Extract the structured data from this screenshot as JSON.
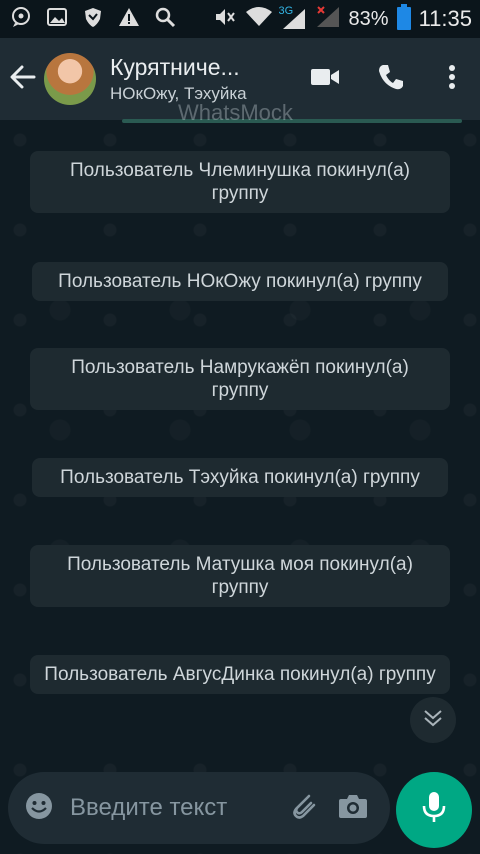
{
  "status_bar": {
    "network_label": "3G",
    "battery_percent": "83%",
    "time": "11:35",
    "icons": [
      "chat-bubble-icon",
      "image-icon",
      "shield-icon",
      "warning-icon",
      "search-icon",
      "mute-icon",
      "wifi-icon",
      "signal-3g-icon",
      "signal-icon",
      "battery-icon"
    ]
  },
  "header": {
    "title": "Курятниче...",
    "subtitle": "НОкОжу, Тэхуйка"
  },
  "watermark": "WhatsMock",
  "messages": [
    {
      "text": "Пользователь Члеминушка покинул(а) группу"
    },
    {
      "text": "Пользователь НОкОжу покинул(а) группу"
    },
    {
      "text": "Пользователь Намрукажёп покинул(а) группу"
    },
    {
      "text": "Пользователь Тэхуйка покинул(а) группу"
    },
    {
      "text": "Пользователь Матушка моя покинул(а) группу"
    },
    {
      "text": "Пользователь АвгусДинка покинул(а) группу"
    }
  ],
  "composer": {
    "placeholder": "Введите текст"
  },
  "colors": {
    "header_bg": "#1f2c34",
    "chat_bg": "#0f1b22",
    "bubble_bg": "#1e2a30",
    "accent": "#00a884"
  }
}
